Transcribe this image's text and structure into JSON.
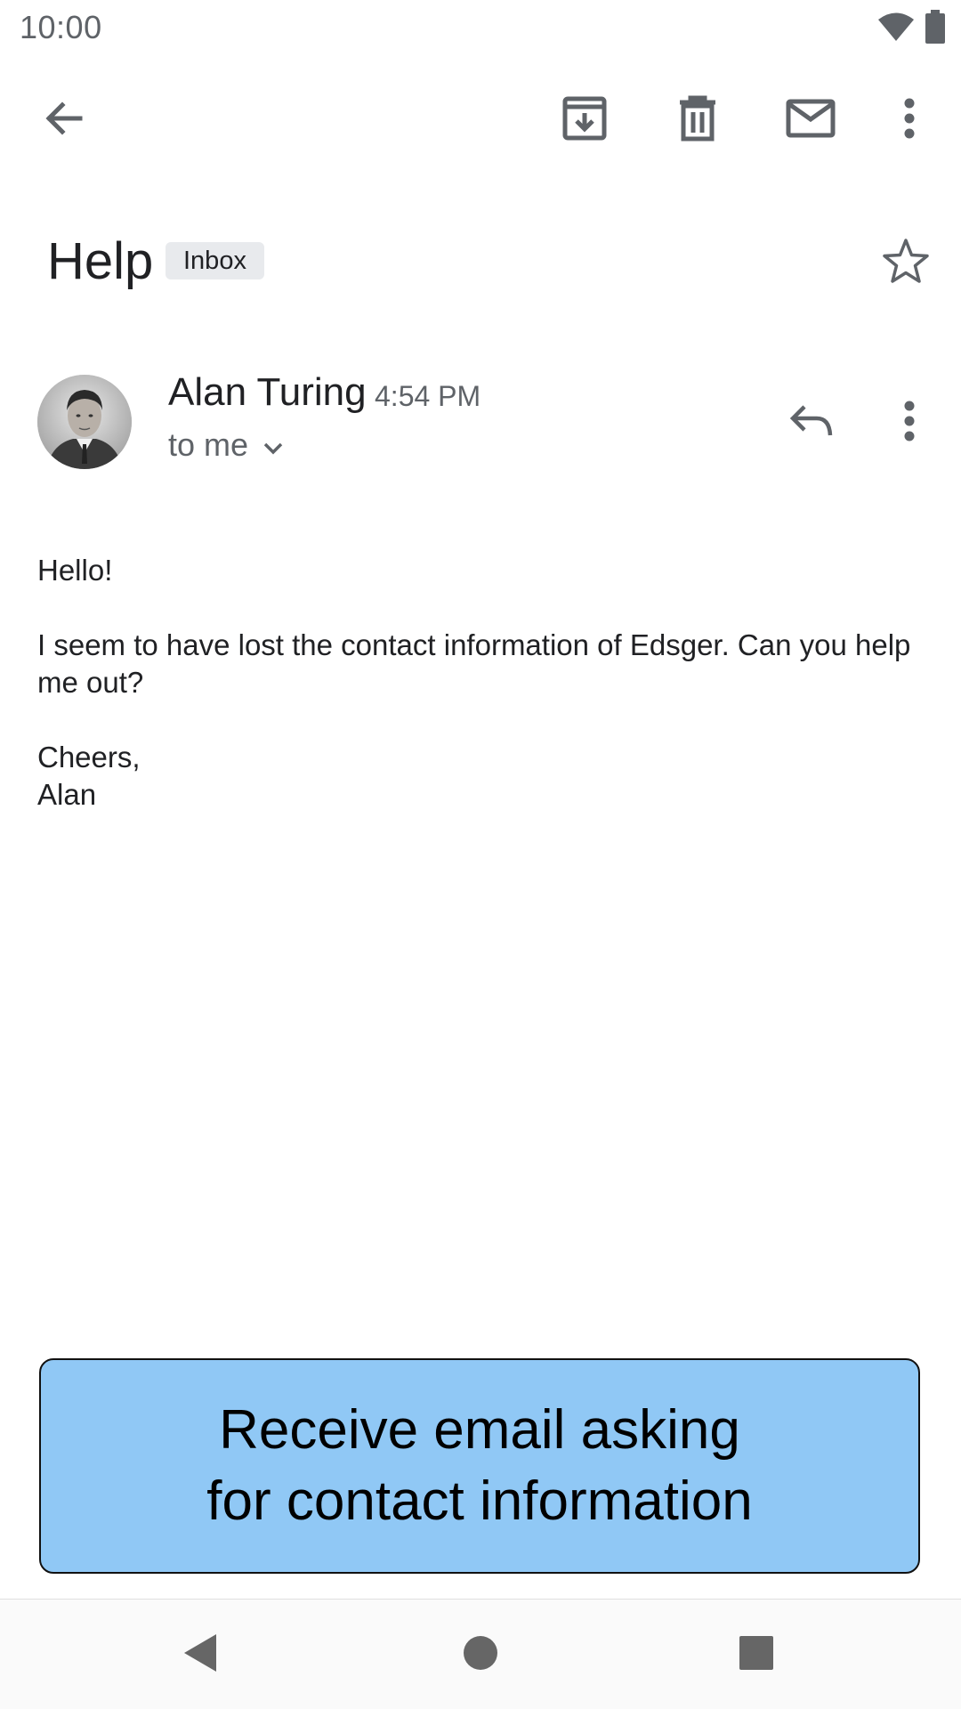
{
  "status_bar": {
    "time": "10:00",
    "icons": [
      "wifi-icon",
      "battery-icon"
    ]
  },
  "toolbar": {
    "icons": [
      "back-arrow-icon",
      "archive-icon",
      "delete-icon",
      "mark-unread-icon",
      "more-vert-icon"
    ]
  },
  "email": {
    "subject": "Help",
    "label": "Inbox",
    "starred": false,
    "sender_name": "Alan Turing",
    "time": "4:54 PM",
    "recipient": "to me",
    "body": {
      "greeting": "Hello!",
      "paragraph": "I seem to have lost the contact information of Edsger. Can you help me out?",
      "closing": "Cheers,",
      "signature": "Alan"
    }
  },
  "caption": {
    "text": "Receive email asking\nfor contact information"
  },
  "colors": {
    "caption_background": "#90c8f5",
    "chip_background": "#e8eaed",
    "icon_gray": "#5f6368"
  }
}
